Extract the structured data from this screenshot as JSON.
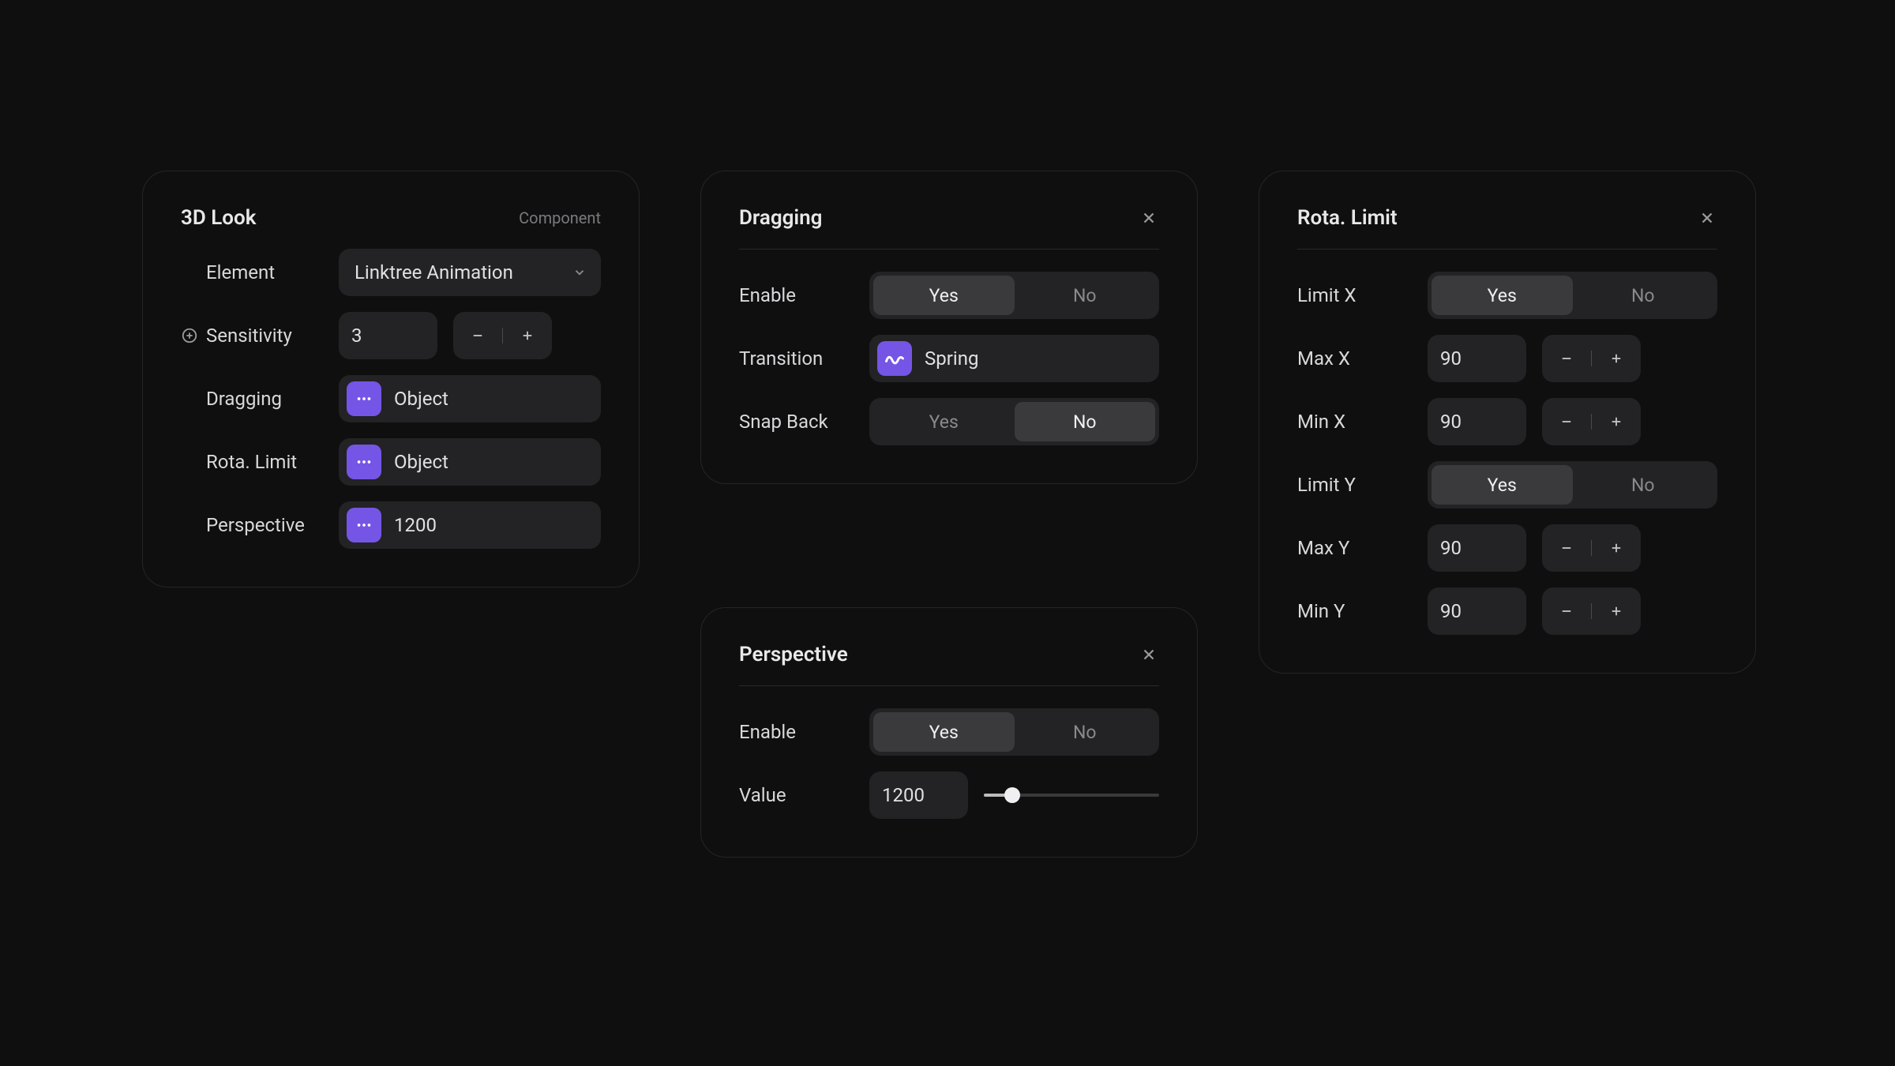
{
  "look3d": {
    "title": "3D Look",
    "subtitle": "Component",
    "element_label": "Element",
    "element_value": "Linktree Animation",
    "sensitivity_label": "Sensitivity",
    "sensitivity_value": "3",
    "dragging_label": "Dragging",
    "dragging_value": "Object",
    "rotalimit_label": "Rota. Limit",
    "rotalimit_value": "Object",
    "perspective_label": "Perspective",
    "perspective_value": "1200"
  },
  "dragging": {
    "title": "Dragging",
    "enable_label": "Enable",
    "transition_label": "Transition",
    "transition_value": "Spring",
    "snapback_label": "Snap Back",
    "yes": "Yes",
    "no": "No"
  },
  "perspective": {
    "title": "Perspective",
    "enable_label": "Enable",
    "value_label": "Value",
    "value": "1200",
    "yes": "Yes",
    "no": "No"
  },
  "rotalimit": {
    "title": "Rota. Limit",
    "limitx_label": "Limit X",
    "maxx_label": "Max X",
    "maxx_value": "90",
    "minx_label": "Min X",
    "minx_value": "90",
    "limity_label": "Limit Y",
    "maxy_label": "Max Y",
    "maxy_value": "90",
    "miny_label": "Min Y",
    "miny_value": "90",
    "yes": "Yes",
    "no": "No"
  }
}
